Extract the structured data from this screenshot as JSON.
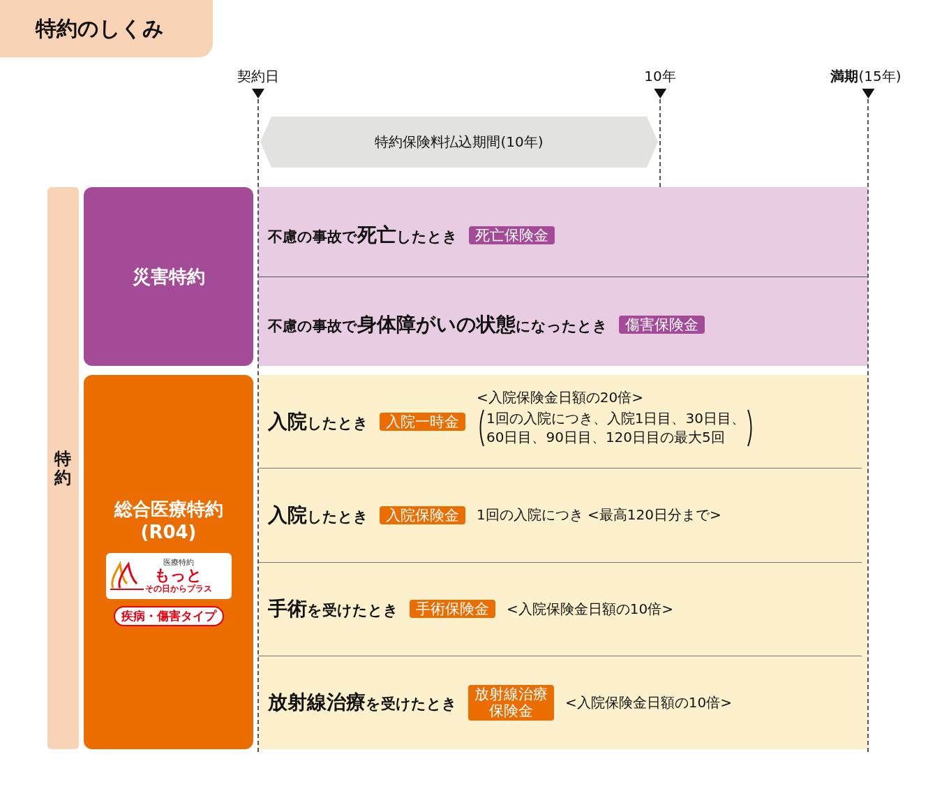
{
  "title": "特約のしくみ",
  "timeline": {
    "markers": [
      {
        "label": "契約日"
      },
      {
        "label": "10年"
      },
      {
        "label": "**満期**(15年)"
      }
    ],
    "payment_period": "特約保険料払込期間(10年)"
  },
  "side_label": "特約",
  "riders": [
    {
      "kind": "disaster",
      "name_lines": [
        "災害特約"
      ],
      "color": "#a34b97",
      "rows": [
        {
          "condition": "不慮の事故で**死亡**したとき",
          "benefit_lines": [
            "死亡保険金"
          ]
        },
        {
          "condition": "不慮の事故で**身体障がいの状態**になったとき",
          "benefit_lines": [
            "傷害保険金"
          ]
        }
      ]
    },
    {
      "kind": "medical",
      "name_lines": [
        "総合医療特約",
        "(R04)"
      ],
      "color": "#eb6d00",
      "logo": {
        "caption": "医療特約",
        "name": "もっと",
        "tagline": "その日からプラス"
      },
      "badge": "疾病・傷害タイプ",
      "rows": [
        {
          "condition": "**入院**したとき",
          "benefit_lines": [
            "入院一時金"
          ],
          "note": "<入院保険金日額の20倍>",
          "paren_lines": [
            "1回の入院につき、入院1日目、30日目、",
            "60日目、90日目、120日目の最大5回"
          ]
        },
        {
          "condition": "**入院**したとき",
          "benefit_lines": [
            "入院保険金"
          ],
          "note": "1回の入院につき <最高120日分まで>"
        },
        {
          "condition": "**手術**を受けたとき",
          "benefit_lines": [
            "手術保険金"
          ],
          "note": "<入院保険金日額の10倍>"
        },
        {
          "condition": "**放射線治療**を受けたとき",
          "benefit_lines": [
            "放射線治療",
            "保険金"
          ],
          "note": "<入院保険金日額の10倍>"
        }
      ]
    }
  ]
}
